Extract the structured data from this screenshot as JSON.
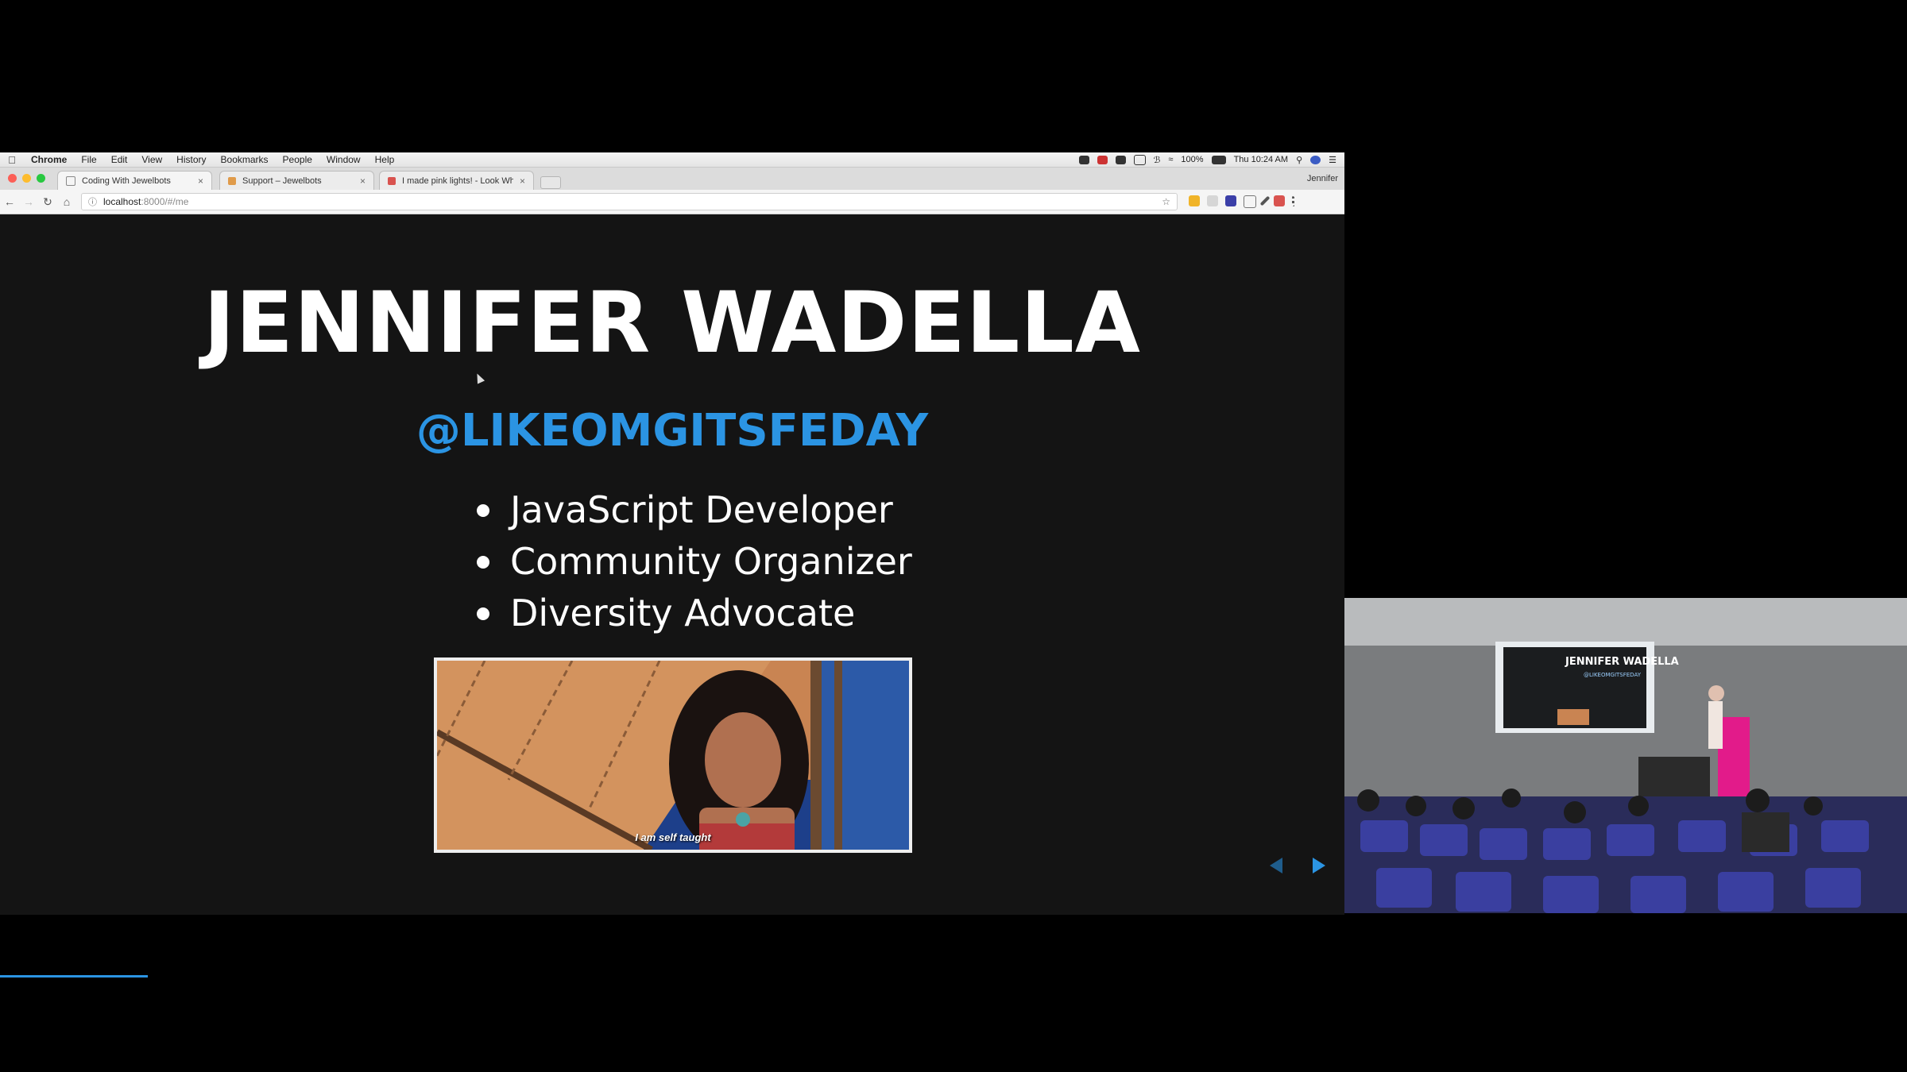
{
  "menubar": {
    "app": "Chrome",
    "items": [
      "File",
      "Edit",
      "View",
      "History",
      "Bookmarks",
      "People",
      "Window",
      "Help"
    ],
    "battery": "100%",
    "clock": "Thu 10:24 AM"
  },
  "tabs": [
    {
      "title": "Coding With Jewelbots",
      "active": true
    },
    {
      "title": "Support – Jewelbots",
      "active": false
    },
    {
      "title": "I made pink lights! - Look Wh",
      "active": false
    }
  ],
  "profile_name": "Jennifer",
  "address": {
    "host": "localhost",
    "path": ":8000/#/me"
  },
  "slide": {
    "title": "JENNIFER WADELLA",
    "handle": "@LIKEOMGITSFEDAY",
    "bullets": [
      "JavaScript Developer",
      "Community Organizer",
      "Diversity Advocate"
    ],
    "gif_caption": "I am self taught"
  },
  "camera_slide": {
    "title": "JENNIFER WADELLA",
    "handle": "@LIKEOMGITSFEDAY"
  },
  "colors": {
    "accent": "#2b94e3",
    "slide_bg": "#141414"
  }
}
